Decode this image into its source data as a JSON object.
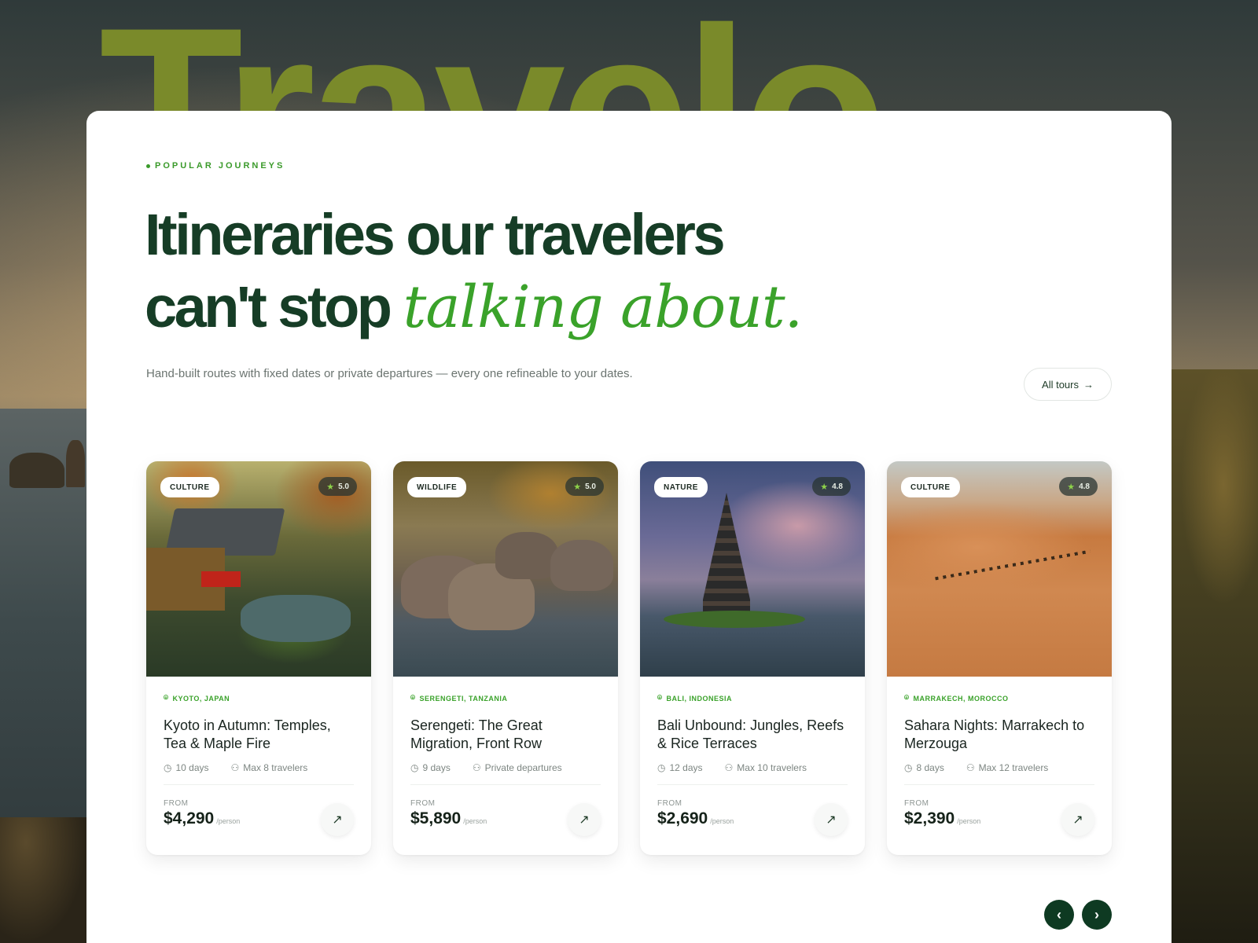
{
  "brand": {
    "word": "Travelo"
  },
  "section": {
    "eyebrow": "POPULAR JOURNEYS",
    "headline_line1": "Itineraries our travelers",
    "headline_line2_plain": "can't stop ",
    "headline_line2_accent": "talking about.",
    "subtitle": "Hand-built routes with fixed dates or private departures — every one refineable to your dates.",
    "all_tours_label": "All tours"
  },
  "cards": [
    {
      "tag": "CULTURE",
      "rating": "5.0",
      "location": "KYOTO, JAPAN",
      "title": "Kyoto in Autumn: Temples, Tea & Maple Fire",
      "duration": "10 days",
      "group": "Max 8 travelers",
      "from_label": "FROM",
      "price": "$4,290",
      "per": "/person"
    },
    {
      "tag": "WILDLIFE",
      "rating": "5.0",
      "location": "SERENGETI, TANZANIA",
      "title": "Serengeti: The Great Migration, Front Row",
      "duration": "9 days",
      "group": "Private departures",
      "from_label": "FROM",
      "price": "$5,890",
      "per": "/person"
    },
    {
      "tag": "NATURE",
      "rating": "4.8",
      "location": "BALI, INDONESIA",
      "title": "Bali Unbound: Jungles, Reefs & Rice Terraces",
      "duration": "12 days",
      "group": "Max 10 travelers",
      "from_label": "FROM",
      "price": "$2,690",
      "per": "/person"
    },
    {
      "tag": "CULTURE",
      "rating": "4.8",
      "location": "MARRAKECH, MOROCCO",
      "title": "Sahara Nights: Marrakech to Merzouga",
      "duration": "8 days",
      "group": "Max 12 travelers",
      "from_label": "FROM",
      "price": "$2,390",
      "per": "/person"
    }
  ],
  "icons": {
    "arrow": "→",
    "star": "★",
    "pin": "⌾",
    "clock": "◷",
    "people": "⚇",
    "go": "↗",
    "prev": "‹",
    "next": "›"
  },
  "colors": {
    "brand_green": "#163d26",
    "accent_green": "#3aa22a",
    "brand_word": "#7a8a2a",
    "pager": "#0e3a22"
  }
}
